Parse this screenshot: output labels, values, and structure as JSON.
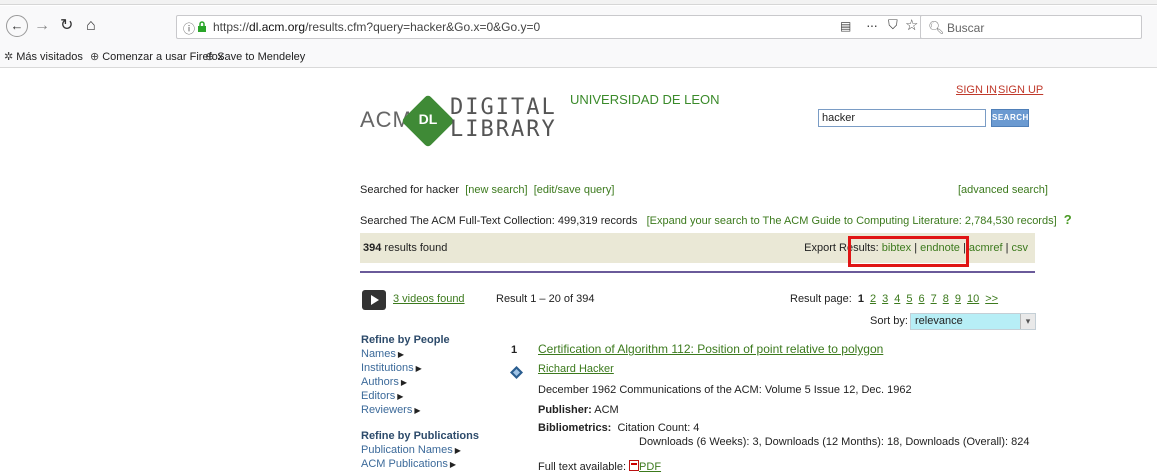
{
  "browser": {
    "url_host": "dl.acm.org",
    "url_prefix": "https://",
    "url_path": "/results.cfm?query=hacker&Go.x=0&Go.y=0",
    "search_placeholder": "Buscar",
    "icons": {
      "back": "back-arrow-icon",
      "forward": "forward-arrow-icon",
      "reload": "reload-icon",
      "home": "home-icon",
      "info": "info-icon",
      "lock": "lock-icon",
      "reader": "reader-view-icon",
      "more": "page-actions-icon",
      "pocket": "pocket-icon",
      "star": "bookmark-star-icon",
      "search": "search-icon"
    },
    "bookmarks": [
      {
        "label": "Más visitados",
        "icon": "gear-icon"
      },
      {
        "label": "Comenzar a usar Firefox",
        "icon": "globe-icon"
      },
      {
        "label": "Save to Mendeley",
        "icon": "globe-icon"
      }
    ]
  },
  "header": {
    "logo_acm": "ACM",
    "logo_dl": "DL",
    "logo_digital": "DIGITAL",
    "logo_library": "LIBRARY",
    "institution": "UNIVERSIDAD DE LEON",
    "sign_in": "SIGN IN",
    "sign_up": "SIGN UP",
    "search_value": "hacker",
    "search_button": "SEARCH"
  },
  "search_info": {
    "searched_for": "Searched for hacker",
    "new_search": "[new search]",
    "edit_save_query": "[edit/save query]",
    "advanced_search": "[advanced search]",
    "collection_text": "Searched The ACM Full-Text Collection: 499,319 records",
    "expand_link": "[Expand your search to The ACM Guide to Computing Literature: 2,784,530 records]",
    "help_icon": "?"
  },
  "results_bar": {
    "count": "394",
    "count_suffix": " results found",
    "export_label": "Export Results: ",
    "exports": [
      "bibtex",
      "endnote",
      "acmref",
      "csv"
    ]
  },
  "pagination": {
    "videos_link": "3 videos found",
    "range": "Result 1 – 20 of 394",
    "page_label": "Result page: ",
    "current_page": "1",
    "pages": [
      "2",
      "3",
      "4",
      "5",
      "6",
      "7",
      "8",
      "9",
      "10",
      ">>"
    ],
    "sort_label": "Sort by:",
    "sort_value": "relevance"
  },
  "refine": {
    "people_heading": "Refine by People",
    "people_items": [
      "Names",
      "Institutions",
      "Authors",
      "Editors",
      "Reviewers"
    ],
    "pubs_heading": "Refine by Publications",
    "pubs_items": [
      "Publication Names",
      "ACM Publications"
    ]
  },
  "results": [
    {
      "number": "1",
      "title": "Certification of Algorithm 112: Position of point relative to polygon",
      "author": "Richard Hacker",
      "date_line": "December 1962   Communications of the ACM: Volume 5 Issue 12, Dec. 1962",
      "publisher_label": "Publisher:",
      "publisher": "ACM",
      "biblio_label": "Bibliometrics:",
      "citation": "Citation Count: 4",
      "downloads": "Downloads (6 Weeks): 3,   Downloads (12 Months): 18,   Downloads (Overall): 824",
      "fulltext_label": "Full text available:",
      "fulltext_link": "PDF"
    }
  ],
  "colors": {
    "link_green": "#3c7a1d",
    "results_bar_bg": "#eae8d6",
    "highlight_red": "#e01515",
    "divider_purple": "#6a5a9a",
    "sort_bg": "#b7eef6"
  }
}
